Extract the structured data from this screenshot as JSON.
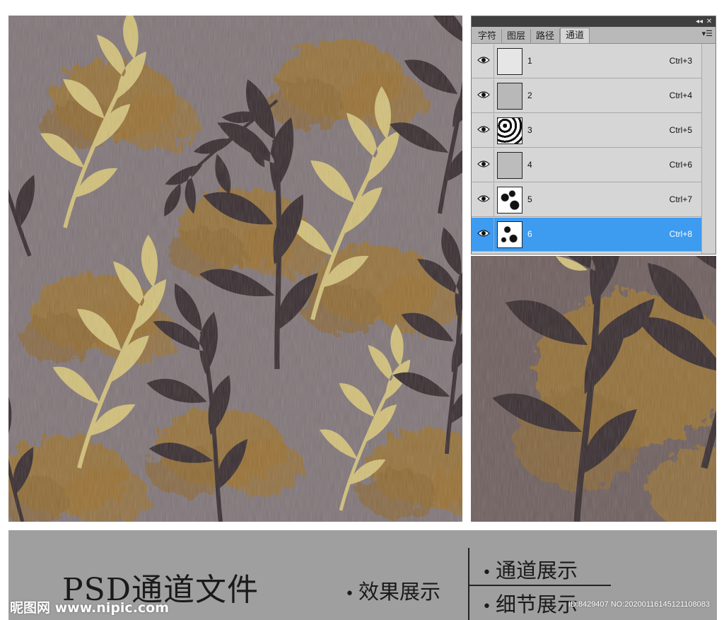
{
  "colors": {
    "background_gray": "#817679",
    "leaf_gold": "#d2c07a",
    "leaf_dark": "#382d30",
    "texture_ochre": "#9a7334",
    "selection_blue": "#3d9bf0",
    "caption_bg": "#a09fa0"
  },
  "ps_panel": {
    "tabs": [
      "字符",
      "图层",
      "路径",
      "通道"
    ],
    "active_tab": "通道",
    "titlebar_buttons": {
      "collapse": "◂◂",
      "close": "✕"
    },
    "menu_icon": "panel-menu-icon",
    "channels": [
      {
        "name": "1",
        "shortcut": "Ctrl+3",
        "visible": true,
        "selected": false
      },
      {
        "name": "2",
        "shortcut": "Ctrl+4",
        "visible": true,
        "selected": false
      },
      {
        "name": "3",
        "shortcut": "Ctrl+5",
        "visible": true,
        "selected": false
      },
      {
        "name": "4",
        "shortcut": "Ctrl+6",
        "visible": true,
        "selected": false
      },
      {
        "name": "5",
        "shortcut": "Ctrl+7",
        "visible": true,
        "selected": false
      },
      {
        "name": "6",
        "shortcut": "Ctrl+8",
        "visible": true,
        "selected": true
      }
    ]
  },
  "caption": {
    "title": "PSD通道文件",
    "effect": "效果展示",
    "channels": "通道展示",
    "detail": "细节展示",
    "bullet": "•"
  },
  "watermark": {
    "logo": "昵图网 www.nipic.com",
    "id": "ID:8429407 NO:20200116145121108083"
  }
}
